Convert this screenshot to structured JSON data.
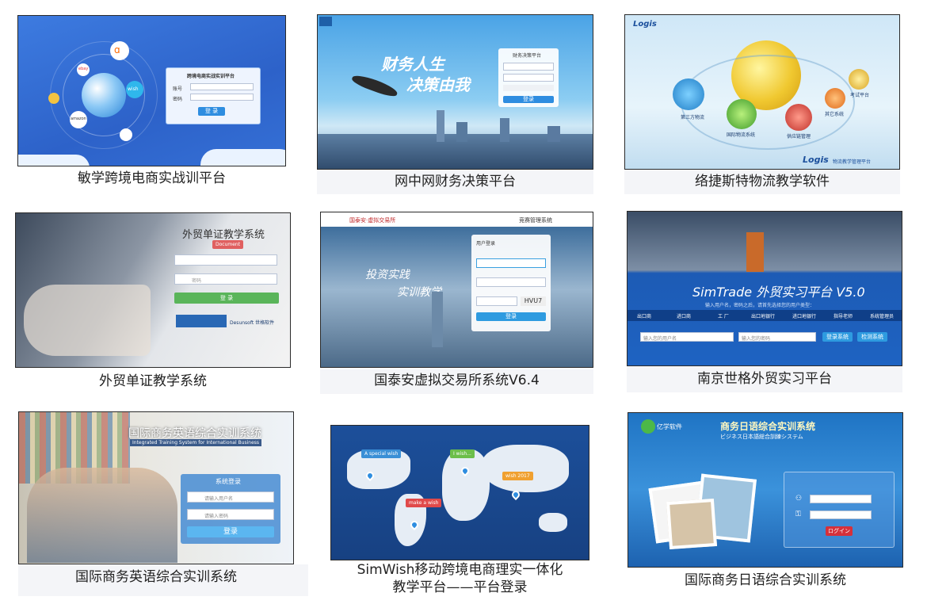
{
  "tiles": [
    {
      "caption": "敏学跨境电商实战训平台",
      "login_title": "跨境电商实战实训平台",
      "field1_label": "账号",
      "field2_label": "密码",
      "button": "登 录",
      "brand_labels": [
        "amazon",
        "wish",
        "ebay"
      ]
    },
    {
      "caption": "网中网财务决策平台",
      "slogan_line1": "财务人生",
      "slogan_line2": "决策由我",
      "login_title": "财务决策平台",
      "button": "登录"
    },
    {
      "caption": "络捷斯特物流教学软件",
      "brand": "Logis",
      "brand_sub": "物流教学管理平台",
      "modules": [
        "第三方物流",
        "国际物流系统",
        "供应链管理",
        "其它系统",
        "考试平台"
      ]
    },
    {
      "caption": "外贸单证教学系统",
      "title": "外贸单证教学系统",
      "badge": "Document",
      "password_placeholder": "密码",
      "button": "登 录",
      "vendor": "Desunsoft 世格软件"
    },
    {
      "caption": "国泰安虚拟交易所系统V6.4",
      "brand": "国泰安·虚拟交易所",
      "header_right": "竞赛管理系统",
      "slogan_line1": "投资实践",
      "slogan_line2": "实训教学",
      "login_title": "用户登录",
      "captcha": "HVU7",
      "button": "登录"
    },
    {
      "caption": "南京世格外贸实习平台",
      "title": "SimTrade 外贸实习平台 V5.0",
      "subtitle": "输入用户名，密码之后，请首先选择您的用户类型：",
      "roles": [
        "出口商",
        "进口商",
        "工 厂",
        "出口地银行",
        "进口地银行",
        "指导老师",
        "系统管理员"
      ],
      "user_placeholder": "输入您的用户名",
      "pass_placeholder": "输入您的密码",
      "login_button": "登录系统",
      "check_button": "检测系统"
    },
    {
      "caption": "国际商务英语综合实训系统",
      "title": "国际商务英语综合实训系统",
      "subtitle": "Integrated Training System for International Business",
      "login_title": "系统登录",
      "user_placeholder": "请输入用户名",
      "pass_placeholder": "请输入密码",
      "button": "登录"
    },
    {
      "caption_line1": "SimWish移动跨境电商理实一体化",
      "caption_line2": "教学平台——平台登录",
      "tags": [
        "A special wish",
        "I wish...",
        "wish 2017",
        "make a wish"
      ]
    },
    {
      "caption": "国际商务日语综合实训系统",
      "logo_text": "亿学软件",
      "title": "商务日语综合实训系统",
      "subtitle": "ビジネス日本語総合訓練システム",
      "button": "ログイン"
    }
  ]
}
